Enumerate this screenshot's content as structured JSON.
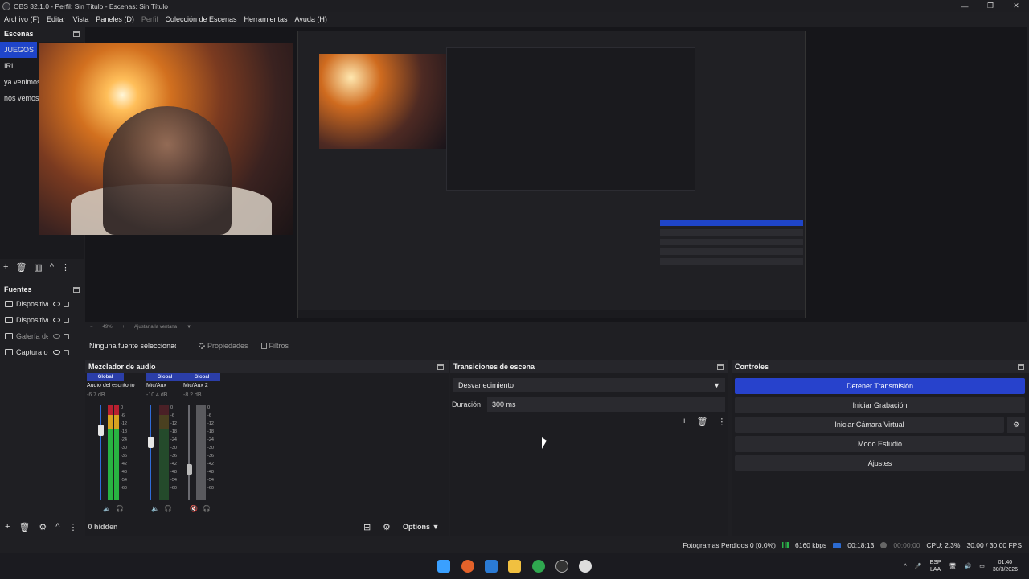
{
  "window": {
    "title": "OBS 32.1.0 - Perfil: Sin Título - Escenas: Sin Título",
    "controls": [
      "—",
      "❐",
      "✕"
    ]
  },
  "menu": [
    "Archivo (F)",
    "Editar",
    "Vista",
    "Paneles (D)",
    "Perfil",
    "Colección de Escenas",
    "Herramientas",
    "Ayuda (H)"
  ],
  "scenes": {
    "title": "Escenas",
    "items": [
      "JUEGOS",
      "IRL",
      "ya venimos",
      "nos vemos"
    ],
    "active_index": 0,
    "toolbar": [
      "+",
      "🗑",
      "▥",
      "^",
      "⋮"
    ]
  },
  "sources": {
    "title": "Fuentes",
    "items": [
      "Dispositivo de captura",
      "Dispositivo de audio",
      "Galería de imágenes",
      "Captura de pantalla"
    ],
    "toolbar": [
      "+",
      "🗑",
      "⚙",
      "^",
      "⋮"
    ]
  },
  "preview_bar": {
    "zoom": "49%",
    "fit": "Ajustar a la ventana"
  },
  "context": {
    "no_source": "Ninguna fuente seleccionada",
    "properties": "Propiedades",
    "filters": "Filtros"
  },
  "mixer": {
    "title": "Mezclador de audio",
    "channels": [
      {
        "group": "Global",
        "name": "Audio del escritorio",
        "db": "-6.7 dB",
        "level": 0.86
      },
      {
        "group": "Global",
        "name": "Mic/Aux",
        "db": "-10.4 dB",
        "level": 0.6
      },
      {
        "group": "Global",
        "name": "Mic/Aux 2",
        "db": "-8.2 dB",
        "level": 0.0
      }
    ],
    "scale": [
      "0",
      "-6",
      "-12",
      "-18",
      "-24",
      "-30",
      "-36",
      "-42",
      "-48",
      "-54",
      "-60"
    ],
    "hidden": "0 hidden",
    "options": "Options"
  },
  "transitions": {
    "title": "Transiciones de escena",
    "selected": "Desvanecimiento",
    "duration_label": "Duración",
    "duration_value": "300 ms"
  },
  "controls": {
    "title": "Controles",
    "buttons": [
      "Detener Transmisión",
      "Iniciar Grabación",
      "Iniciar Cámara Virtual",
      "Modo Estudio",
      "Ajustes"
    ]
  },
  "status": {
    "dropped": "Fotogramas Perdidos 0 (0.0%)",
    "bitrate": "6160 kbps",
    "stream_time": "00:18:13",
    "rec_time": "00:00:00",
    "cpu": "CPU: 2.3%",
    "fps": "30.00 / 30.00 FPS"
  },
  "taskbar": {
    "lang_top": "ESP",
    "lang_bottom": "LAA",
    "time": "01:40",
    "date": "30/3/2026"
  },
  "colors": {
    "accent": "#2742cc",
    "bg": "#1f1f23"
  }
}
